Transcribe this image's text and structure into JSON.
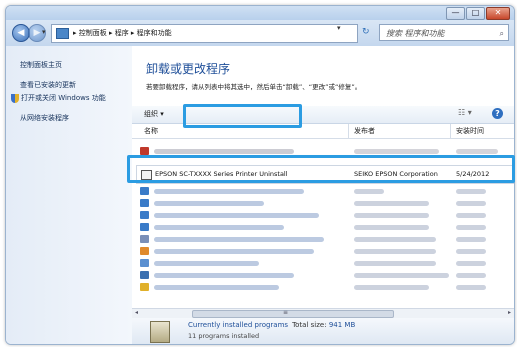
{
  "window": {
    "min_glyph": "—",
    "max_glyph": "□",
    "close_glyph": "✕"
  },
  "nav": {
    "back_glyph": "◀",
    "forward_glyph": "▶",
    "dropdown_glyph": "▾",
    "breadcrumb": "▸ 控制面板 ▸ 程序 ▸ 程序和功能",
    "refresh_glyph": "↻",
    "search_placeholder": "搜索 程序和功能",
    "search_glyph": "⌕"
  },
  "sidebar": {
    "items": [
      {
        "label": "控制面板主页"
      },
      {
        "label": "查看已安装的更新"
      },
      {
        "label": "打开或关闭 Windows 功能"
      },
      {
        "label": "从网络安装程序"
      }
    ]
  },
  "main": {
    "heading": "卸载或更改程序",
    "description": "若要卸载程序，请从列表中将其选中，然后单击“卸载”、“更改”或“修复”。"
  },
  "toolbar": {
    "organize_label": "组织 ▾",
    "view_glyph": "☷ ▾",
    "help_glyph": "?"
  },
  "table": {
    "headers": {
      "name": "名称",
      "publisher": "发布者",
      "date": "安装时间"
    },
    "highlighted": {
      "name": "EPSON SC-TXXXX Series Printer Uninstall",
      "publisher": "SEIKO EPSON Corporation",
      "date": "5/24/2012"
    }
  },
  "details": {
    "title": "Currently installed programs",
    "size_label": "Total size:",
    "size_value": "941 MB",
    "count": "11 programs installed"
  },
  "scroll": {
    "left_glyph": "◂",
    "right_glyph": "▸",
    "grip_glyph": "≡"
  },
  "colors": {
    "accent": "#2b9ce2",
    "heading_blue": "#1f4f99"
  }
}
